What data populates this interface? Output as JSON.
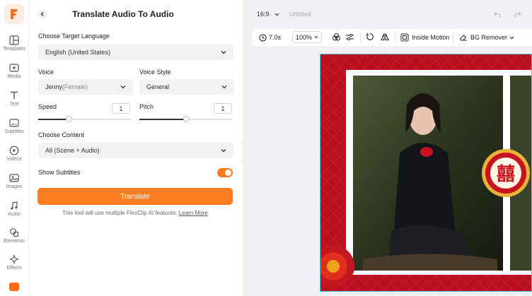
{
  "sidebar": {
    "items": [
      {
        "label": "Templates",
        "icon": "templates-icon"
      },
      {
        "label": "Media",
        "icon": "media-icon"
      },
      {
        "label": "Text",
        "icon": "text-icon"
      },
      {
        "label": "Subtitles",
        "icon": "subtitles-icon"
      },
      {
        "label": "Videos",
        "icon": "videos-icon"
      },
      {
        "label": "Images",
        "icon": "images-icon"
      },
      {
        "label": "Audio",
        "icon": "audio-icon"
      },
      {
        "label": "Elements",
        "icon": "elements-icon"
      },
      {
        "label": "Effects",
        "icon": "effects-icon"
      }
    ]
  },
  "panel": {
    "title": "Translate Audio To Audio",
    "target_language_label": "Choose Target Language",
    "target_language_value": "English (United States)",
    "voice_label": "Voice",
    "voice_name": "Jenny",
    "voice_gender": "(Female)",
    "voice_style_label": "Voice Style",
    "voice_style_value": "General",
    "speed_label": "Speed",
    "speed_value": "1",
    "pitch_label": "Pitch",
    "pitch_value": "1",
    "speed_level": 0.33,
    "pitch_level": 0.5,
    "content_label": "Choose Content",
    "content_value": "All (Scene + Audio)",
    "show_subtitles_label": "Show Subtitles",
    "show_subtitles_on": true,
    "translate_button": "Translate",
    "note_text": "This tool will use multiple FlexClip AI features.",
    "learn_more": "Learn More"
  },
  "editor": {
    "aspect_ratio": "16:9",
    "project_name": "Untitled",
    "toolbar": {
      "duration": "7.0s",
      "zoom": "100%",
      "inside_motion": "Inside Motion",
      "bg_remover": "BG Remover"
    }
  },
  "colors": {
    "accent": "#ff7d23",
    "canvas_frame_red": "#b8101e",
    "selection_border": "#5ac8e0"
  }
}
